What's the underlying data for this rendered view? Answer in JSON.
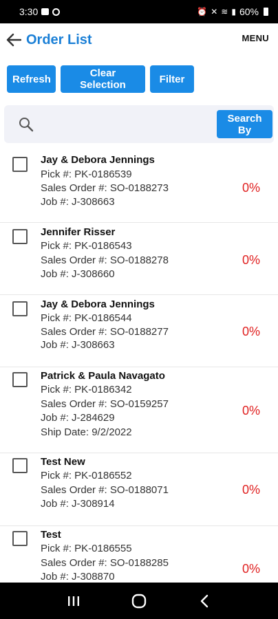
{
  "status_bar": {
    "time": "3:30",
    "battery": "60%"
  },
  "header": {
    "title": "Order List",
    "menu_label": "MENU"
  },
  "toolbar": {
    "refresh_label": "Refresh",
    "clear_label": "Clear Selection",
    "filter_label": "Filter"
  },
  "search": {
    "value": "",
    "placeholder": "",
    "search_by_label": "Search\nBy"
  },
  "orders": [
    {
      "name": "Jay & Debora Jennings",
      "pick": "Pick #: PK-0186539",
      "sales_order": "Sales Order #: SO-0188273",
      "job": "Job #: J-308663",
      "ship_date": "",
      "percent": "0%"
    },
    {
      "name": "Jennifer Risser",
      "pick": "Pick #: PK-0186543",
      "sales_order": "Sales Order #: SO-0188278",
      "job": "Job #: J-308660",
      "ship_date": "",
      "percent": "0%"
    },
    {
      "name": "Jay & Debora Jennings",
      "pick": "Pick #: PK-0186544",
      "sales_order": "Sales Order #: SO-0188277",
      "job": "Job #: J-308663",
      "ship_date": "",
      "percent": "0%"
    },
    {
      "name": "Patrick & Paula Navagato",
      "pick": "Pick #: PK-0186342",
      "sales_order": "Sales Order #: SO-0159257",
      "job": "Job #: J-284629",
      "ship_date": "Ship Date: 9/2/2022",
      "percent": "0%"
    },
    {
      "name": "Test New",
      "pick": "Pick #: PK-0186552",
      "sales_order": "Sales Order #: SO-0188071",
      "job": "Job #: J-308914",
      "ship_date": "",
      "percent": "0%"
    },
    {
      "name": "Test",
      "pick": "Pick #: PK-0186555",
      "sales_order": "Sales Order #: SO-0188285",
      "job": "Job #: J-308870",
      "ship_date": "",
      "percent": "0%"
    }
  ],
  "colors": {
    "accent": "#1a8be6",
    "title": "#1a7fd6",
    "percent": "#e02020"
  },
  "icons": {
    "back": "arrow-left-icon",
    "search": "search-icon",
    "nav_recents": "recents-icon",
    "nav_home": "home-icon",
    "nav_back": "back-icon"
  }
}
